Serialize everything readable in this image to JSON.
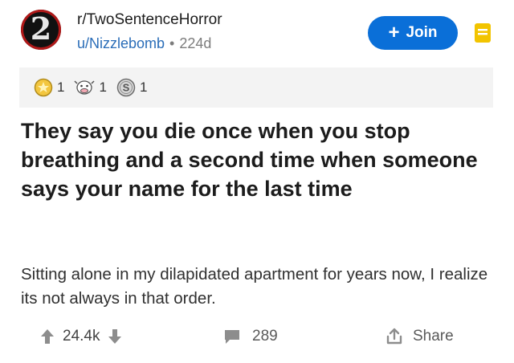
{
  "post": {
    "avatar_text": "2",
    "subreddit": "r/TwoSentenceHorror",
    "author": "u/Nizzlebomb",
    "separator": "•",
    "age": "224d",
    "join_label": "Join",
    "awards": [
      {
        "icon": "gold-award-icon",
        "count": "1"
      },
      {
        "icon": "cow-award-icon",
        "count": "1"
      },
      {
        "icon": "silver-award-icon",
        "count": "1"
      }
    ],
    "title": "They say you die once when you stop breathing and a second time when someone says your name for the last time",
    "body": "Sitting alone in my dilapidated apartment for years now, I realize its not always in that order.",
    "votes": "24.4k",
    "comments": "289",
    "share_label": "Share"
  },
  "colors": {
    "accent": "#0a6fd8",
    "author": "#2a6db8",
    "award_bar": "#f3f3f3",
    "save_icon": "#f2c400"
  }
}
